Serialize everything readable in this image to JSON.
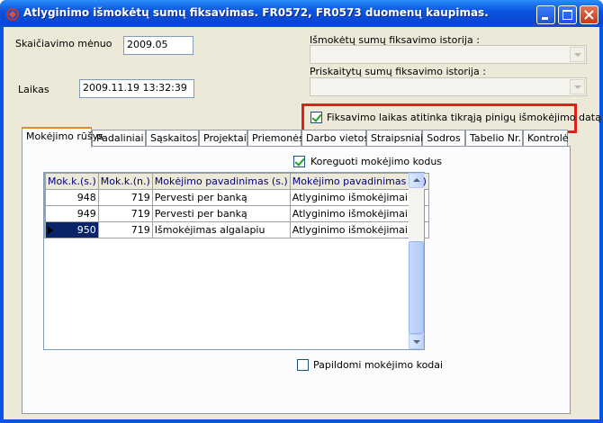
{
  "window": {
    "title": "Atlyginimo išmokėtų sumų fiksavimas. FR0572, FR0573 duomenų kaupimas."
  },
  "form": {
    "month_label": "Skaičiavimo mėnuo",
    "month_value": "2009.05",
    "time_label": "Laikas",
    "time_value": "2009.11.19 13:32:39",
    "paid_history_label": "Išmokėtų sumų fiksavimo istorija :",
    "paid_history_value": "",
    "accrued_history_label": "Priskaitytų sumų fiksavimo istorija :",
    "accrued_history_value": "",
    "fix_time_checkbox_label": "Fiksavimo laikas atitinka tikrąją pinigų išmokėjimo datą",
    "fix_time_checked": true,
    "highlight_color": "#e0201b"
  },
  "tabs": [
    {
      "label": "Mokėjimo rūšys",
      "active": true
    },
    {
      "label": "Padaliniai"
    },
    {
      "label": "Sąskaitos"
    },
    {
      "label": "Projektai"
    },
    {
      "label": "Priemonės"
    },
    {
      "label": "Darbo vietos"
    },
    {
      "label": "Straipsniai"
    },
    {
      "label": "Sodros"
    },
    {
      "label": "Tabelio Nr."
    },
    {
      "label": "Kontrolė"
    }
  ],
  "payment_tab": {
    "correct_codes_label": "Koreguoti mokėjimo kodus",
    "correct_codes_checked": true,
    "extra_codes_label": "Papildomi mokėjimo kodai",
    "extra_codes_checked": false
  },
  "grid": {
    "columns": [
      "Mok.k.(s.)",
      "Mok.k.(n.)",
      "Mokėjimo pavadinimas (s.)",
      "Mokėjimo pavadinimas (n.)"
    ],
    "rows": [
      [
        "948",
        "719",
        "Pervesti per banką",
        "Atlyginimo išmokėjimai"
      ],
      [
        "949",
        "719",
        "Pervesti per banką",
        "Atlyginimo išmokėjimai"
      ],
      [
        "950",
        "719",
        "Išmokėjimas algalapiu",
        "Atlyginimo išmokėjimai"
      ]
    ],
    "current_row": 2
  }
}
